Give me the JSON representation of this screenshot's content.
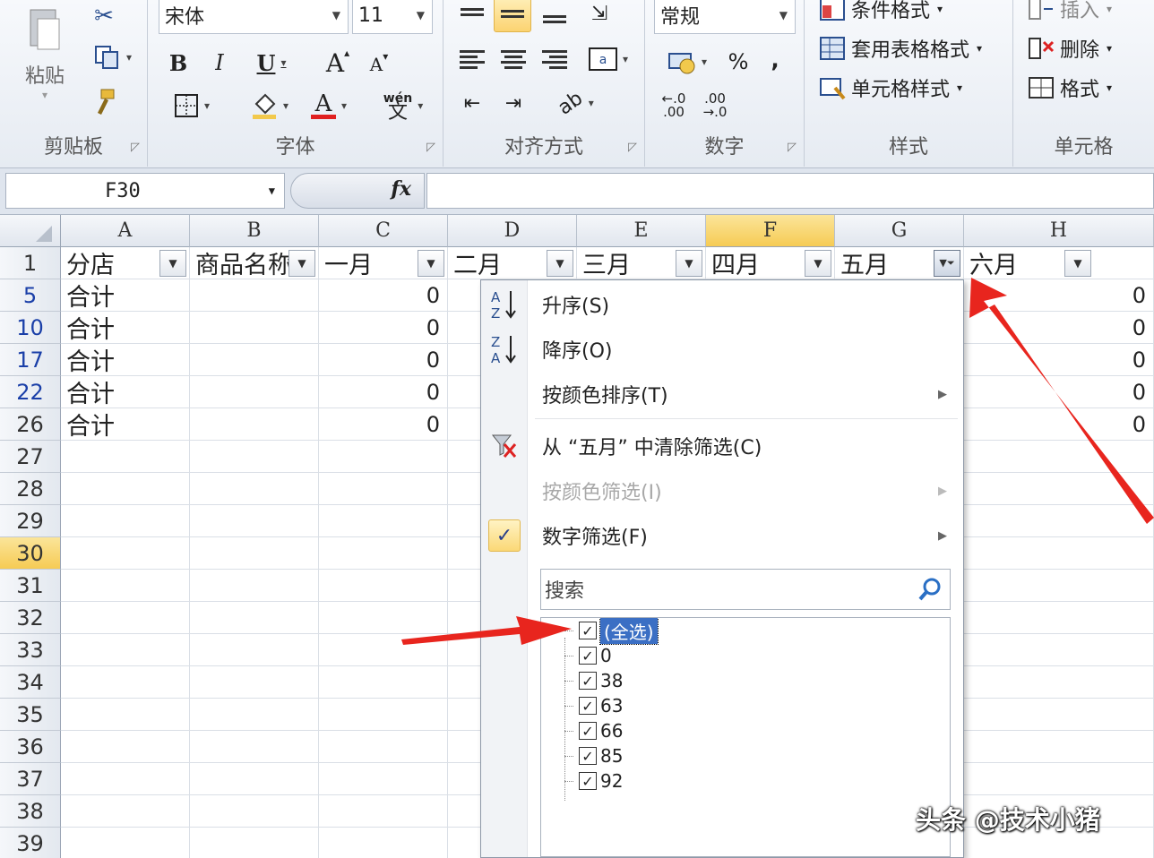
{
  "ribbon": {
    "clipboard": {
      "label": "剪贴板",
      "paste_label": "粘贴"
    },
    "font": {
      "label": "字体",
      "font_name": "宋体",
      "font_size": "11",
      "bold": "B",
      "italic": "I",
      "underline": "U",
      "grow": "A",
      "shrink": "A",
      "font_color_glyph": "A",
      "phonetic": "wén"
    },
    "alignment": {
      "label": "对齐方式"
    },
    "number": {
      "label": "数字",
      "format": "常规",
      "percent": "%",
      "comma": ",",
      "inc_decimal": ".00",
      "dec_decimal": ".00"
    },
    "styles": {
      "label": "样式",
      "conditional": "条件格式",
      "table_format": "套用表格格式",
      "cell_styles": "单元格样式"
    },
    "cells": {
      "label": "单元格",
      "insert": "插入",
      "delete": "删除",
      "format": "格式"
    }
  },
  "formula_bar": {
    "name_box": "F30",
    "fx": "fx",
    "formula": ""
  },
  "columns": [
    "A",
    "B",
    "C",
    "D",
    "E",
    "F",
    "G",
    "H"
  ],
  "selected_column": "F",
  "header_row": {
    "row_number": "1",
    "cells": [
      "分店",
      "商品名称",
      "一月",
      "二月",
      "三月",
      "四月",
      "五月",
      "六月"
    ]
  },
  "rows": [
    {
      "num": "5",
      "filtered": true,
      "a": "合计",
      "c": "0",
      "h": "0"
    },
    {
      "num": "10",
      "filtered": true,
      "a": "合计",
      "c": "0",
      "h": "0"
    },
    {
      "num": "17",
      "filtered": true,
      "a": "合计",
      "c": "0",
      "h": "0"
    },
    {
      "num": "22",
      "filtered": true,
      "a": "合计",
      "c": "0",
      "h": "0"
    },
    {
      "num": "26",
      "filtered": false,
      "a": "合计",
      "c": "0",
      "h": "0"
    },
    {
      "num": "27"
    },
    {
      "num": "28"
    },
    {
      "num": "29"
    },
    {
      "num": "30",
      "selected": true
    },
    {
      "num": "31"
    },
    {
      "num": "32"
    },
    {
      "num": "33"
    },
    {
      "num": "34"
    },
    {
      "num": "35"
    },
    {
      "num": "36"
    },
    {
      "num": "37"
    },
    {
      "num": "38"
    },
    {
      "num": "39"
    }
  ],
  "filter_menu": {
    "sort_asc": "升序(S)",
    "sort_desc": "降序(O)",
    "sort_by_color": "按颜色排序(T)",
    "clear_filter": "从 “五月” 中清除筛选(C)",
    "filter_by_color": "按颜色筛选(I)",
    "number_filter": "数字筛选(F)",
    "search_placeholder": "搜索",
    "select_all": "(全选)",
    "values": [
      "0",
      "38",
      "63",
      "66",
      "85",
      "92"
    ]
  },
  "watermark": "头条 @技术小猪",
  "colors": {
    "selected_header": "#f6cb54",
    "arrow": "#e8251e",
    "filtered_row_number": "#1a3fa8"
  }
}
